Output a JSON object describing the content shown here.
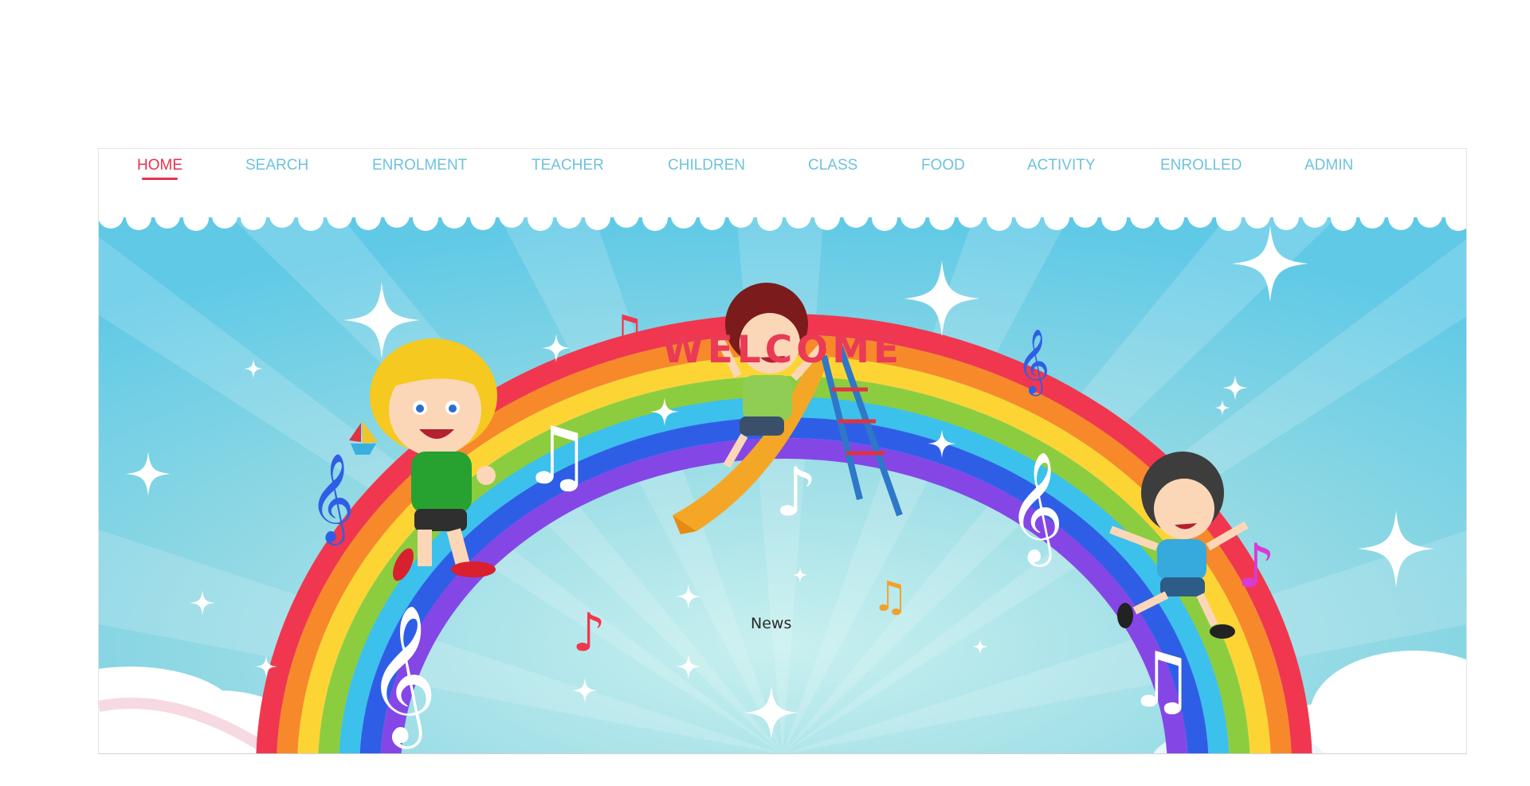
{
  "nav": {
    "items": [
      {
        "label": "HOME",
        "active": true
      },
      {
        "label": "SEARCH",
        "active": false
      },
      {
        "label": "ENROLMENT",
        "active": false
      },
      {
        "label": "TEACHER",
        "active": false
      },
      {
        "label": "CHILDREN",
        "active": false
      },
      {
        "label": "CLASS",
        "active": false
      },
      {
        "label": "FOOD",
        "active": false
      },
      {
        "label": "ACTIVITY",
        "active": false
      },
      {
        "label": "ENROLLED",
        "active": false
      },
      {
        "label": "ADMIN",
        "active": false
      }
    ]
  },
  "hero": {
    "welcome": "WELCOME",
    "news_link": "News"
  },
  "colors": {
    "nav_text": "#6fc2dd",
    "nav_active": "#e8314f",
    "welcome": "#ea3a55",
    "sky": "#7fd3e6"
  },
  "icons": [
    "treble-clef-icon",
    "eighth-note-icon",
    "beamed-notes-icon",
    "sparkle-icon"
  ]
}
